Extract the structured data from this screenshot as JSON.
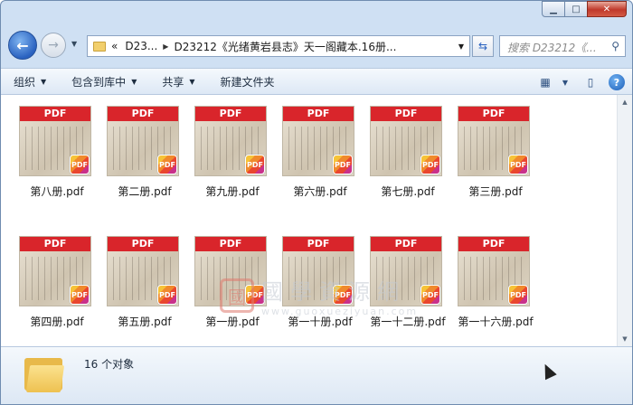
{
  "window": {
    "min_label": "▁",
    "max_label": "□",
    "close_label": "✕"
  },
  "nav": {
    "back_label": "←",
    "forward_label": "→",
    "address_prefix": "«",
    "address_seg1": "D23...",
    "address_seg2": "D23212《光绪黄岩县志》天一阁藏本.16册...",
    "search_placeholder": "搜索 D23212《..."
  },
  "toolbar": {
    "organize": "组织",
    "include_in_library": "包含到库中",
    "share": "共享",
    "new_folder": "新建文件夹"
  },
  "files": [
    {
      "name": "第八册.pdf"
    },
    {
      "name": "第二册.pdf"
    },
    {
      "name": "第九册.pdf"
    },
    {
      "name": "第六册.pdf"
    },
    {
      "name": "第七册.pdf"
    },
    {
      "name": "第三册.pdf"
    },
    {
      "name": "第四册.pdf"
    },
    {
      "name": "第五册.pdf"
    },
    {
      "name": "第一册.pdf"
    },
    {
      "name": "第一十册.pdf"
    },
    {
      "name": "第一十二册.pdf"
    },
    {
      "name": "第一十六册.pdf"
    }
  ],
  "thumb_label": "PDF",
  "badge_label": "PDF",
  "watermark": {
    "seal": "國",
    "title": "國學資源網",
    "url": "www.guoxueziyuan.com"
  },
  "details": {
    "count": "16 个对象"
  }
}
